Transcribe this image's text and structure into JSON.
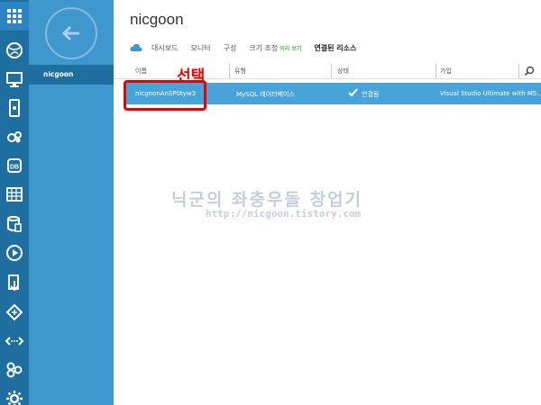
{
  "app": {
    "title": "nicgoon"
  },
  "rail": {
    "icons": [
      "grid-icon",
      "globe-icon",
      "monitor-icon",
      "mobile-icon",
      "cloud-gear-icon",
      "db-icon",
      "table-icon",
      "storage-icon",
      "media-icon",
      "deploy-icon",
      "network-icon",
      "connect-icon",
      "cluster-icon",
      "gear-icon"
    ]
  },
  "panel": {
    "item": "nicgoon"
  },
  "tabs": [
    "대시보드",
    "모니터",
    "구성",
    "크기 조정",
    "연결된 리소스"
  ],
  "tab_preview": "미리 보기",
  "table": {
    "headers": [
      "이름",
      "유형",
      "상태",
      "가입"
    ],
    "row": {
      "name": "nicgoonAnSP0tyw3",
      "type": "MySQL 데이터베이스",
      "status": "연결됨",
      "subscription": "Visual Studio Ultimate with MS..."
    }
  },
  "annotation": {
    "label": "선택"
  },
  "watermark": {
    "text": "닉군의 좌충우돌 창업기",
    "url": "http://nicgoon.tistory.com"
  },
  "colors": {
    "rail": "#1e6f9f",
    "panel": "#3f98cd",
    "row": "#47a3d8",
    "annotation": "#e00000"
  }
}
